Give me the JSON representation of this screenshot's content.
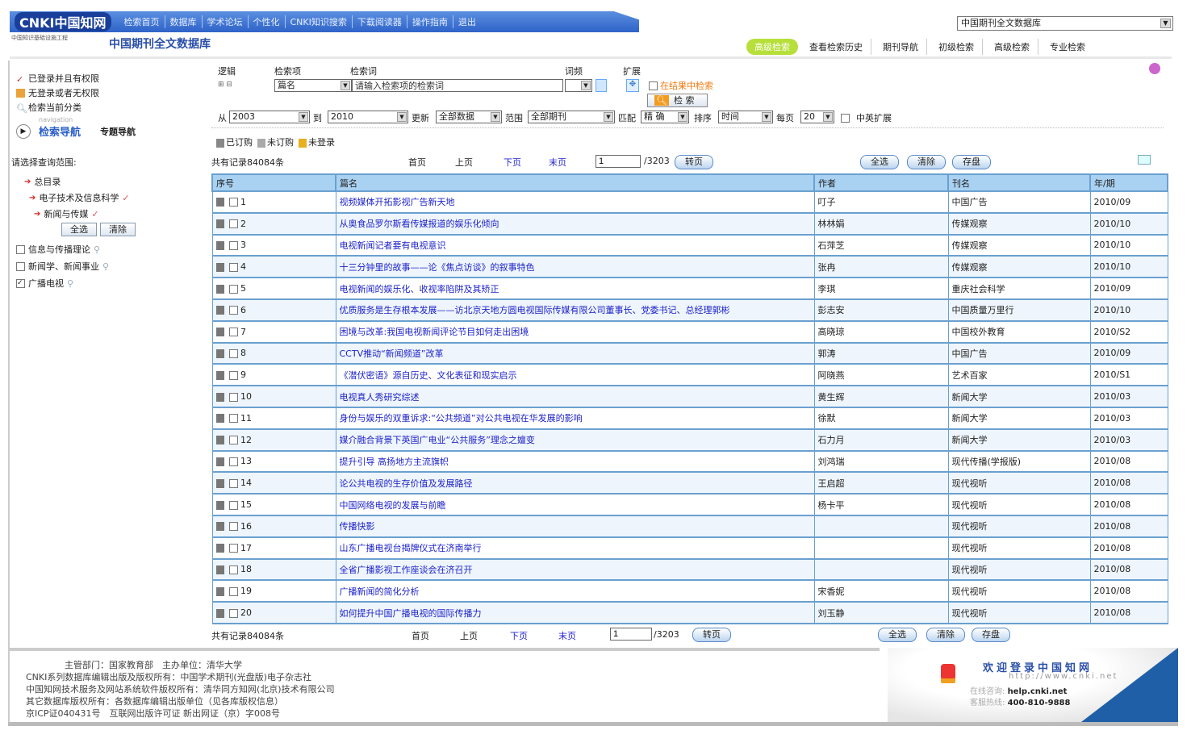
{
  "header": {
    "logo": "CNKI中国知网",
    "nav": [
      "检索首页",
      "数据库",
      "学术论坛",
      "个性化",
      "CNKI知识搜索",
      "下载阅读器",
      "操作指南",
      "退出"
    ],
    "sub_logo": "中国知识基础设施工程",
    "db_title": "中国期刊全文数据库",
    "db_select": "中国期刊全文数据库",
    "tabs": [
      "高级检索",
      "查看检索历史",
      "期刊导航",
      "初级检索",
      "高级检索",
      "专业检索"
    ]
  },
  "sidebar": {
    "legend": [
      "已登录并且有权限",
      "无登录或者无权限",
      "检索当前分类"
    ],
    "nav_label": "检索导航",
    "nav_sub": "navigation",
    "nav_alt": "专题导航",
    "scope_title": "请选择查询范围:",
    "tree": [
      "总目录",
      "电子技术及信息科学",
      "新闻与传媒"
    ],
    "select_all": "全选",
    "clear": "清除",
    "categories": [
      {
        "label": "信息与传播理论",
        "checked": false
      },
      {
        "label": "新闻学、新闻事业",
        "checked": false
      },
      {
        "label": "广播电视",
        "checked": true
      }
    ]
  },
  "search": {
    "headers": {
      "logic": "逻辑",
      "field": "检索项",
      "term": "检索词",
      "freq": "词频",
      "expand": "扩展"
    },
    "logic_value": "⊞ ⊟",
    "field_value": "篇名",
    "term_placeholder": "请输入检索项的检索词",
    "in_results": "在结果中检索",
    "search_btn": "检 索",
    "from_label": "从",
    "from": "2003",
    "to_label": "到",
    "to": "2010",
    "update_label": "更新",
    "update": "全部数据",
    "range_label": "范围",
    "range": "全部期刊",
    "match_label": "匹配",
    "match": "精 确",
    "sort_label": "排序",
    "sort": "时间",
    "per_page_label": "每页",
    "per_page": "20",
    "cn_en": "中英扩展"
  },
  "status_legend": [
    "已订购",
    "未订购",
    "未登录"
  ],
  "pagination_top": {
    "total": "共有记录84084条",
    "first": "首页",
    "prev": "上页",
    "next": "下页",
    "last": "末页",
    "page": "1",
    "of": "/3203",
    "go": "转页"
  },
  "pagination_bottom": {
    "total": "共有记录84084条",
    "first": "首页",
    "prev": "上页",
    "next": "下页",
    "last": "末页",
    "page": "1",
    "of": "/3203",
    "go": "转页"
  },
  "actions": {
    "select_all": "全选",
    "clear": "清除",
    "save": "存盘"
  },
  "table": {
    "columns": [
      "序号",
      "篇名",
      "作者",
      "刊名",
      "年/期"
    ],
    "rows": [
      [
        "1",
        "视频媒体开拓影视广告新天地",
        "叮子",
        "中国广告",
        "2010/09"
      ],
      [
        "2",
        "从奥食品罗尔斯看传媒报道的娱乐化倾向",
        "林林娟",
        "传媒观察",
        "2010/10"
      ],
      [
        "3",
        "电视新闻记者要有电视意识",
        "石萍芝",
        "传媒观察",
        "2010/10"
      ],
      [
        "4",
        "十三分钟里的故事——论《焦点访谈》的叙事特色",
        "张冉",
        "传媒观察",
        "2010/10"
      ],
      [
        "5",
        "电视新闻的娱乐化、收视率陷阱及其矫正",
        "李琪",
        "重庆社会科学",
        "2010/09"
      ],
      [
        "6",
        "优质服务是生存根本发展——访北京天地方圆电视国际传媒有限公司董事长、党委书记、总经理郭彬",
        "彭志安",
        "中国质量万里行",
        "2010/10"
      ],
      [
        "7",
        "困境与改革:我国电视新闻评论节目如何走出困境",
        "高晓琼",
        "中国校外教育",
        "2010/S2"
      ],
      [
        "8",
        "CCTV推动“新闻频道”改革",
        "郭涛",
        "中国广告",
        "2010/09"
      ],
      [
        "9",
        "《潜伏密语》源自历史、文化表征和现实启示",
        "阿晓燕",
        "艺术百家",
        "2010/S1"
      ],
      [
        "10",
        "电视真人秀研究综述",
        "黄生辉",
        "新闻大学",
        "2010/03"
      ],
      [
        "11",
        "身份与娱乐的双重诉求:“公共频道”对公共电视在华发展的影响",
        "徐默",
        "新闻大学",
        "2010/03"
      ],
      [
        "12",
        "媒介融合背景下英国广电业“公共服务”理念之嬗变",
        "石力月",
        "新闻大学",
        "2010/03"
      ],
      [
        "13",
        "提升引导 高扬地方主流旗帜",
        "刘鸿瑞",
        "现代传播(学报版)",
        "2010/08"
      ],
      [
        "14",
        "论公共电视的生存价值及发展路径",
        "王启超",
        "现代视听",
        "2010/08"
      ],
      [
        "15",
        "中国网络电视的发展与前瞻",
        "杨卡平",
        "现代视听",
        "2010/08"
      ],
      [
        "16",
        "传播快影",
        "",
        "现代视听",
        "2010/08"
      ],
      [
        "17",
        "山东广播电视台揭牌仪式在济南举行",
        "",
        "现代视听",
        "2010/08"
      ],
      [
        "18",
        "全省广播影视工作座谈会在济召开",
        "",
        "现代视听",
        "2010/08"
      ],
      [
        "19",
        "广播新闻的简化分析",
        "宋香妮",
        "现代视听",
        "2010/08"
      ],
      [
        "20",
        "如何提升中国广播电视的国际传播力",
        "刘玉静",
        "现代视听",
        "2010/08"
      ]
    ]
  },
  "footer": {
    "lines": [
      "主管部门：国家教育部　主办单位：清华大学",
      "CNKI系列数据库编辑出版及版权所有：中国学术期刊(光盘版)电子杂志社",
      "中国知网技术服务及网站系统软件版权所有：清华同方知网(北京)技术有限公司",
      "其它数据库版权所有：各数据库编辑出版单位（见各库版权信息）",
      "京ICP证040431号　互联网出版许可证 新出网证（京）字008号"
    ],
    "banner_title": "欢迎登录中国知网",
    "banner_url": "http://www.cnki.net",
    "banner_help_label": "在线咨询:",
    "banner_help": "help.cnki.net",
    "banner_phone_label": "客服热线:",
    "banner_phone": "400-810-9888"
  }
}
